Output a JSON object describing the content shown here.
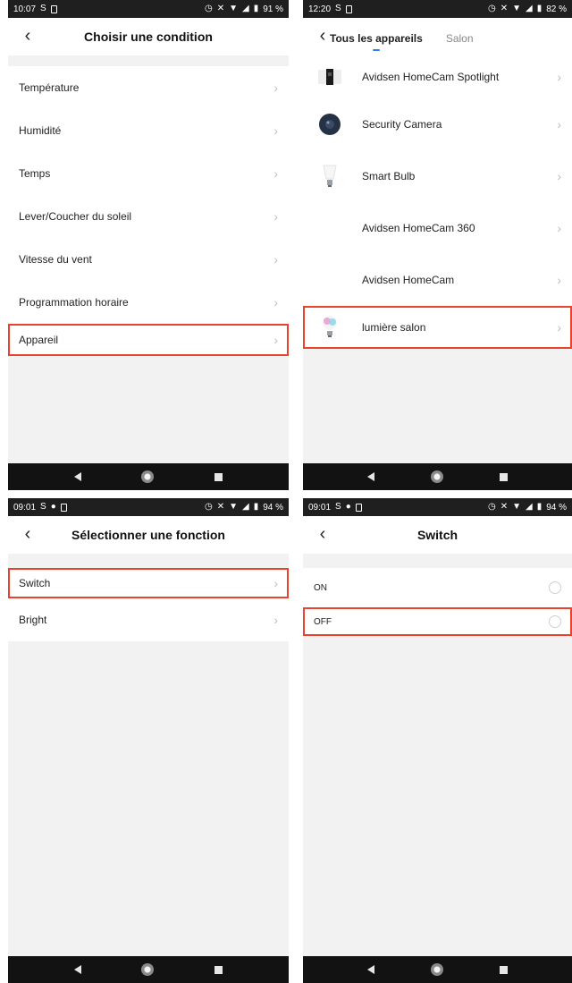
{
  "screen1": {
    "status": {
      "time": "10:07",
      "battery": "91 %"
    },
    "title": "Choisir une condition",
    "items": [
      {
        "label": "Température"
      },
      {
        "label": "Humidité"
      },
      {
        "label": "Temps"
      },
      {
        "label": "Lever/Coucher du soleil"
      },
      {
        "label": "Vitesse du vent"
      },
      {
        "label": "Programmation horaire"
      },
      {
        "label": "Appareil"
      }
    ]
  },
  "screen2": {
    "status": {
      "time": "12:20",
      "battery": "82 %"
    },
    "tabs": [
      {
        "label": "Tous les appareils"
      },
      {
        "label": "Salon"
      }
    ],
    "devices": [
      {
        "label": "Avidsen HomeCam Spotlight",
        "icon": "spotlight-camera-icon"
      },
      {
        "label": "Security Camera",
        "icon": "security-camera-icon"
      },
      {
        "label": "Smart Bulb",
        "icon": "bulb-icon"
      },
      {
        "label": "Avidsen HomeCam 360",
        "icon": ""
      },
      {
        "label": "Avidsen HomeCam",
        "icon": ""
      },
      {
        "label": "lumière salon",
        "icon": "color-bulb-icon"
      }
    ]
  },
  "screen3": {
    "status": {
      "time": "09:01",
      "battery": "94 %"
    },
    "title": "Sélectionner une fonction",
    "items": [
      {
        "label": "Switch"
      },
      {
        "label": "Bright"
      }
    ]
  },
  "screen4": {
    "status": {
      "time": "09:01",
      "battery": "94 %"
    },
    "title": "Switch",
    "options": [
      {
        "label": "ON"
      },
      {
        "label": "OFF"
      }
    ]
  },
  "colors": {
    "highlight": "#e8442d",
    "tab_indicator": "#2d7cf6",
    "statusbar": "#1f1f1f",
    "navbar": "#121212",
    "background": "#f2f2f2"
  }
}
